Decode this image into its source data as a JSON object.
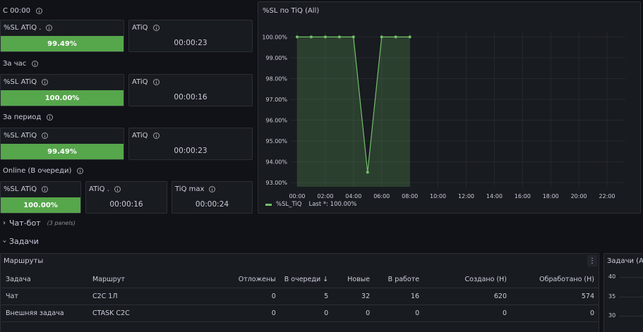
{
  "sections": {
    "s1": "С 00:00",
    "s2": "За час",
    "s3": "За период",
    "s4": "Online (В очереди)"
  },
  "stats": {
    "s1_sl": {
      "title": "%SL ATiQ .",
      "value": "99.49%"
    },
    "s1_atiq": {
      "title": "ATiQ",
      "value": "00:00:23"
    },
    "s2_sl": {
      "title": "%SL ATiQ",
      "value": "100.00%"
    },
    "s2_atiq": {
      "title": "ATiQ",
      "value": "00:00:16"
    },
    "s3_sl": {
      "title": "%SL ATiQ",
      "value": "99.49%"
    },
    "s3_atiq": {
      "title": "ATiQ",
      "value": "00:00:23"
    },
    "s4_sl": {
      "title": "%SL ATiQ",
      "value": "100.00%"
    },
    "s4_atiq": {
      "title": "ATiQ .",
      "value": "00:00:16"
    },
    "s4_tiqmax": {
      "title": "TiQ max",
      "value": "00:00:24"
    }
  },
  "colors": {
    "accent_green": "#56a64b",
    "panel_bg": "#181b1f",
    "page_bg": "#111217"
  },
  "chart_panel": {
    "title": "%SL по TiQ (All)",
    "legend": {
      "series": "%SL_TiQ",
      "last": "Last *: 100.00%"
    }
  },
  "chart_data": {
    "type": "area",
    "title": "%SL по TiQ (All)",
    "x_ticks": [
      "00:00",
      "02:00",
      "04:00",
      "06:00",
      "08:00",
      "10:00",
      "12:00",
      "14:00",
      "16:00",
      "18:00",
      "20:00",
      "22:00"
    ],
    "y_ticks": [
      "100.00%",
      "99.00%",
      "98.00%",
      "97.00%",
      "96.00%",
      "95.00%",
      "94.00%",
      "93.00%"
    ],
    "ylim": [
      92.8,
      100.25
    ],
    "xlim_hours": [
      -0.5,
      23.3
    ],
    "series": [
      {
        "name": "%SL_TiQ",
        "x_hours": [
          0,
          1,
          2,
          3,
          4,
          5,
          6,
          7,
          8
        ],
        "values": [
          100.0,
          100.0,
          100.0,
          100.0,
          100.0,
          93.5,
          100.0,
          100.0,
          100.0
        ]
      }
    ],
    "legend_position": "bottom-left",
    "grid": true
  },
  "rows": {
    "chatbot": {
      "title": "Чат-бот",
      "count": "(3 panels)"
    },
    "tasks": {
      "title": "Задачи"
    }
  },
  "routes": {
    "title": "Маршруты",
    "columns": [
      "Задача",
      "Маршрут",
      "Отложены",
      "В очереди",
      "Новые",
      "В работе",
      "Создано (Н)",
      "Обработано (Н)"
    ],
    "sort_icon": "↓",
    "rows": [
      [
        "Чат",
        "C2C 1Л",
        "0",
        "5",
        "32",
        "16",
        "620",
        "574"
      ],
      [
        "Внешняя задача",
        "CTASK C2C",
        "0",
        "0",
        "0",
        "0",
        "0",
        "0"
      ]
    ]
  },
  "tasks_panel": {
    "title": "Задачи (All",
    "y_ticks": [
      "40",
      "35",
      "30"
    ]
  }
}
